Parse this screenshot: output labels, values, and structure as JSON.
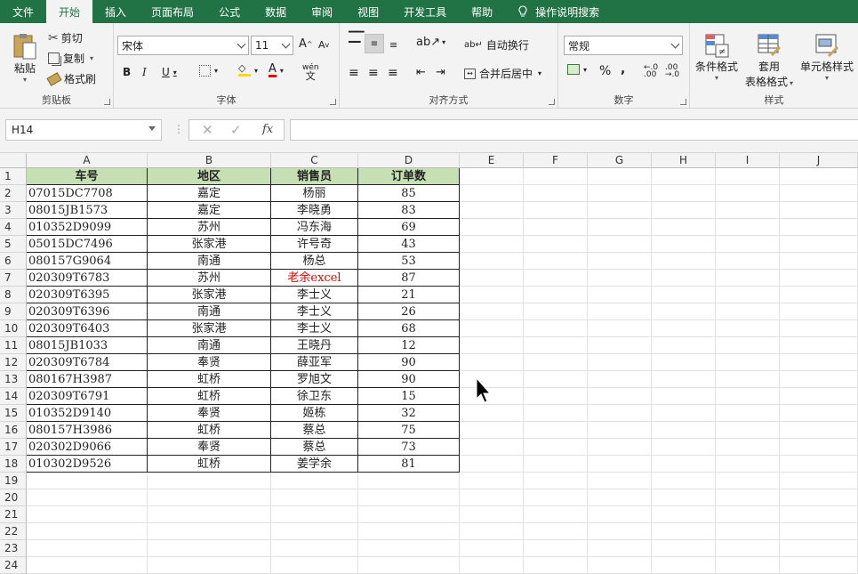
{
  "tabs": [
    "文件",
    "开始",
    "插入",
    "页面布局",
    "公式",
    "数据",
    "审阅",
    "视图",
    "开发工具",
    "帮助",
    "操作说明搜索"
  ],
  "ribbon": {
    "clipboard": {
      "paste": "粘贴",
      "cut": "剪切",
      "copy": "复制",
      "format_painter": "格式刷",
      "label": "剪贴板"
    },
    "font": {
      "name": "宋体",
      "size": "11",
      "grow": "A",
      "shrink": "A",
      "bold": "B",
      "italic": "I",
      "underline": "U",
      "wen": "wén",
      "label": "字体"
    },
    "align": {
      "wrap": "自动换行",
      "merge": "合并后居中",
      "label": "对齐方式"
    },
    "number": {
      "format": "常规",
      "percent": "%",
      "comma": ",",
      "label": "数字"
    },
    "styles": {
      "cond": "条件格式",
      "table1": "套用",
      "table2": "表格格式",
      "cell": "单元格样式",
      "label": "样式"
    }
  },
  "formula_bar": {
    "name_box": "H14",
    "fx": "fx",
    "formula": ""
  },
  "columns": [
    "A",
    "B",
    "C",
    "D",
    "E",
    "F",
    "G",
    "H",
    "I",
    "J"
  ],
  "row_numbers": [
    "1",
    "2",
    "3",
    "4",
    "5",
    "6",
    "7",
    "8",
    "9",
    "10",
    "11",
    "12",
    "13",
    "14",
    "15",
    "16",
    "17",
    "18",
    "19",
    "20",
    "21",
    "22",
    "23",
    "24"
  ],
  "table": {
    "headers": [
      "车号",
      "地区",
      "销售员",
      "订单数"
    ],
    "rows": [
      [
        "07015DC7708",
        "嘉定",
        "杨丽",
        "85"
      ],
      [
        "08015JB1573",
        "嘉定",
        "李晓勇",
        "83"
      ],
      [
        "010352D9099",
        "苏州",
        "冯东海",
        "69"
      ],
      [
        "05015DC7496",
        "张家港",
        "许号奇",
        "43"
      ],
      [
        "080157G9064",
        "南通",
        "杨总",
        "53"
      ],
      [
        "020309T6783",
        "苏州",
        "老余excel",
        "87"
      ],
      [
        "020309T6395",
        "张家港",
        "李士义",
        "21"
      ],
      [
        "020309T6396",
        "南通",
        "李士义",
        "26"
      ],
      [
        "020309T6403",
        "张家港",
        "李士义",
        "68"
      ],
      [
        "08015JB1033",
        "南通",
        "王晓丹",
        "12"
      ],
      [
        "020309T6784",
        "奉贤",
        "薛亚军",
        "90"
      ],
      [
        "080167H3987",
        "虹桥",
        "罗旭文",
        "90"
      ],
      [
        "020309T6791",
        "虹桥",
        "徐卫东",
        "15"
      ],
      [
        "010352D9140",
        "奉贤",
        "姬栋",
        "32"
      ],
      [
        "080157H3986",
        "虹桥",
        "蔡总",
        "75"
      ],
      [
        "020302D9066",
        "奉贤",
        "蔡总",
        "73"
      ],
      [
        "010302D9526",
        "虹桥",
        "姜学余",
        "81"
      ]
    ]
  },
  "colors": {
    "accent": "#217346",
    "header_fill": "#c6e0b4",
    "red_text": "#e00000"
  }
}
